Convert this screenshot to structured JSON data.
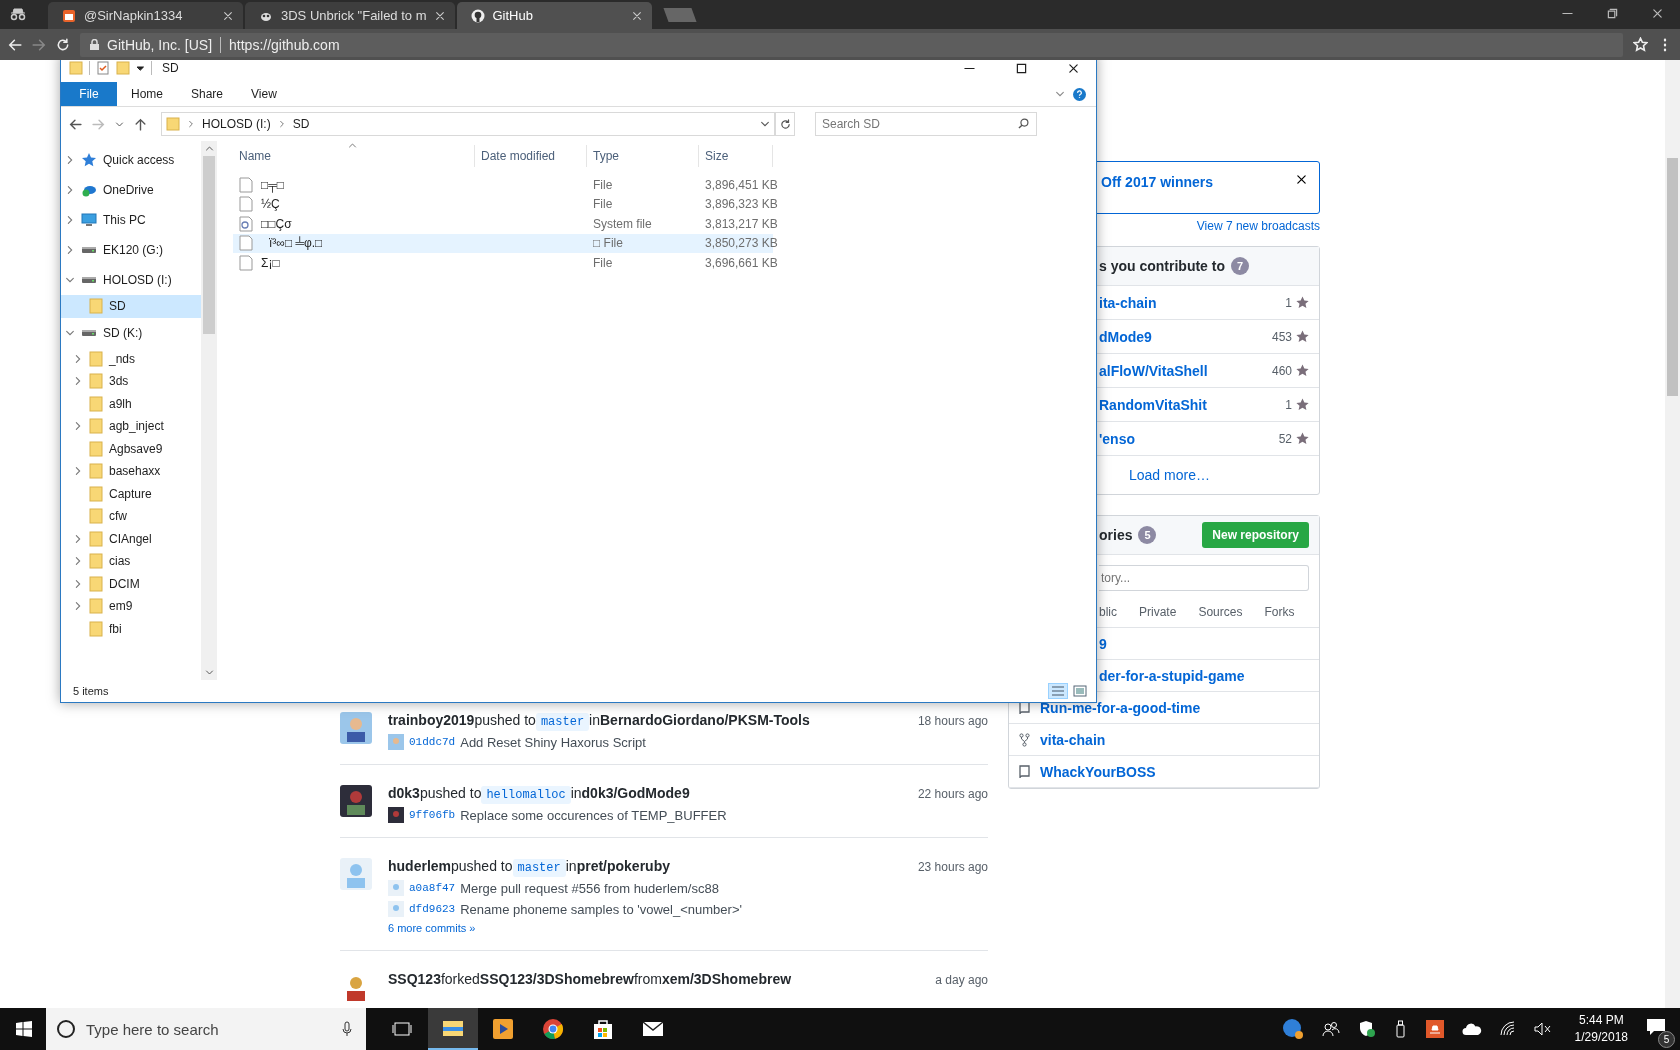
{
  "browser": {
    "tabs": [
      {
        "title": "@SirNapkin1334",
        "kind": "calendar",
        "selected": false
      },
      {
        "title": "3DS Unbrick \"Failed to m",
        "kind": "bug",
        "selected": false
      },
      {
        "title": "GitHub",
        "kind": "github",
        "selected": true
      }
    ],
    "site_identity": "GitHub, Inc. [US]",
    "url": "https://github.com"
  },
  "feed": [
    {
      "kind": "push",
      "user": "trainboy2019",
      "action": "pushed to",
      "branch": "master",
      "prep": "in",
      "repo": "BernardoGiordano/PKSM-Tools",
      "time": "18 hours ago",
      "commits": [
        {
          "sha": "01ddc7d",
          "message": "Add Reset Shiny Haxorus Script"
        }
      ]
    },
    {
      "kind": "push",
      "user": "d0k3",
      "action": "pushed to",
      "branch": "hellomalloc",
      "prep": "in",
      "repo": "d0k3/GodMode9",
      "time": "22 hours ago",
      "commits": [
        {
          "sha": "9ff06fb",
          "message": "Replace some occurences of TEMP_BUFFER"
        }
      ]
    },
    {
      "kind": "push",
      "user": "huderlem",
      "action": "pushed to",
      "branch": "master",
      "prep": "in",
      "repo": "pret/pokeruby",
      "time": "23 hours ago",
      "commits": [
        {
          "sha": "a0a8f47",
          "message": "Merge pull request #556 from huderlem/sc88"
        },
        {
          "sha": "dfd9623",
          "message": "Rename phoneme samples to 'vowel_<number>'"
        }
      ],
      "more": "6 more commits »"
    },
    {
      "kind": "fork",
      "user": "SSQ123",
      "action": "forked",
      "target": "SSQ123/3DShomebrew",
      "prep": "from",
      "repo": "xem/3DShomebrew",
      "time": "a day ago"
    }
  ],
  "sidebar": {
    "broadcast": {
      "text": "Off 2017 winners",
      "link": "View 7 new broadcasts"
    },
    "contributed": {
      "title": "s you contribute to",
      "count": "7",
      "repos": [
        {
          "name": "ita-chain",
          "star_count": "1"
        },
        {
          "name": "dMode9",
          "star_count": "453"
        },
        {
          "name": "alFloW/VitaShell",
          "star_count": "460"
        },
        {
          "name": "RandomVitaShit",
          "star_count": "1"
        },
        {
          "name": "'enso",
          "star_count": "52"
        }
      ],
      "load_more": "Load more…"
    },
    "repositories": {
      "title": "ories",
      "count": "5",
      "new_button": "New repository",
      "filter": {
        "placeholder": "tory..."
      },
      "filters": [
        "blic",
        "Private",
        "Sources",
        "Forks"
      ],
      "repos": [
        {
          "name": "9"
        },
        {
          "name": "der-for-a-stupid-game"
        },
        {
          "name": "Run-me-for-a-good-time",
          "kind": "repo"
        },
        {
          "name": "vita-chain",
          "kind": "fork"
        },
        {
          "name": "WhackYourBOSS",
          "kind": "repo"
        }
      ]
    }
  },
  "explorer": {
    "title": "SD",
    "ribbon_tabs": [
      {
        "label": "File",
        "selected": true
      },
      {
        "label": "Home",
        "selected": false
      },
      {
        "label": "Share",
        "selected": false
      },
      {
        "label": "View",
        "selected": false
      }
    ],
    "breadcrumb": [
      "HOLOSD (I:)",
      "SD"
    ],
    "search": {
      "placeholder": "Search SD"
    },
    "nav": [
      {
        "label": "Quick access",
        "kind": "star",
        "expandable": true,
        "expanded": false,
        "selected": false
      },
      {
        "label": "OneDrive",
        "kind": "cloud",
        "expandable": true,
        "expanded": false,
        "selected": false
      },
      {
        "label": "This PC",
        "kind": "pc",
        "expandable": true,
        "expanded": false,
        "selected": false
      },
      {
        "label": "EK120 (G:)",
        "kind": "drive",
        "expandable": true,
        "expanded": false,
        "selected": false
      },
      {
        "label": "HOLOSD (I:)",
        "kind": "drive",
        "expandable": true,
        "expanded": true,
        "selected": false,
        "children": [
          {
            "label": "SD",
            "kind": "folder",
            "expandable": false,
            "selected": true
          }
        ]
      },
      {
        "label": "SD (K:)",
        "kind": "drive",
        "expandable": true,
        "expanded": true,
        "selected": false,
        "children": [
          {
            "label": "_nds",
            "kind": "folder",
            "expandable": true,
            "expanded": false,
            "selected": false
          },
          {
            "label": "3ds",
            "kind": "folder",
            "expandable": true,
            "expanded": false,
            "selected": false
          },
          {
            "label": "a9lh",
            "kind": "folder",
            "expandable": false,
            "selected": false
          },
          {
            "label": "agb_inject",
            "kind": "folder",
            "expandable": true,
            "expanded": false,
            "selected": false
          },
          {
            "label": "Agbsave9",
            "kind": "folder",
            "expandable": false,
            "selected": false
          },
          {
            "label": "basehaxx",
            "kind": "folder",
            "expandable": true,
            "expanded": false,
            "selected": false
          },
          {
            "label": "Capture",
            "kind": "folder",
            "expandable": false,
            "selected": false
          },
          {
            "label": "cfw",
            "kind": "folder",
            "expandable": false,
            "selected": false
          },
          {
            "label": "CIAngel",
            "kind": "folder",
            "expandable": true,
            "expanded": false,
            "selected": false
          },
          {
            "label": "cias",
            "kind": "folder",
            "expandable": true,
            "expanded": false,
            "selected": false
          },
          {
            "label": "DCIM",
            "kind": "folder",
            "expandable": true,
            "expanded": false,
            "selected": false
          },
          {
            "label": "em9",
            "kind": "folder",
            "expandable": true,
            "expanded": false,
            "selected": false
          },
          {
            "label": "fbi",
            "kind": "folder",
            "expandable": false,
            "selected": false
          }
        ]
      }
    ],
    "columns": [
      "Name",
      "Date modified",
      "Type",
      "Size"
    ],
    "files": [
      {
        "name": "□╤□",
        "kind": "file",
        "type": "File",
        "size": "3,896,451 KB",
        "selected": false
      },
      {
        "name": "½Ç",
        "kind": "file",
        "type": "File",
        "size": "3,896,323 KB",
        "selected": false
      },
      {
        "name": "□□Çσ",
        "kind": "system",
        "type": "System file",
        "size": "3,813,217 KB",
        "selected": false
      },
      {
        "name": "ï³∞□ ╧φ.□",
        "kind": "file",
        "type": "□ File",
        "size": "3,850,273 KB",
        "selected": true
      },
      {
        "name": "Σ¡□",
        "kind": "file",
        "type": "File",
        "size": "3,696,661 KB",
        "selected": false
      }
    ],
    "status": "5 items"
  },
  "taskbar": {
    "search": {
      "placeholder": "Type here to search"
    },
    "apps": [
      {
        "kind": "explorer",
        "selected": true
      },
      {
        "kind": "media",
        "selected": false
      },
      {
        "kind": "chrome",
        "selected": false
      },
      {
        "kind": "store",
        "selected": false
      },
      {
        "kind": "mail",
        "selected": false
      }
    ],
    "time": "5:44 PM",
    "date": "1/29/2018",
    "notifications": "5"
  }
}
